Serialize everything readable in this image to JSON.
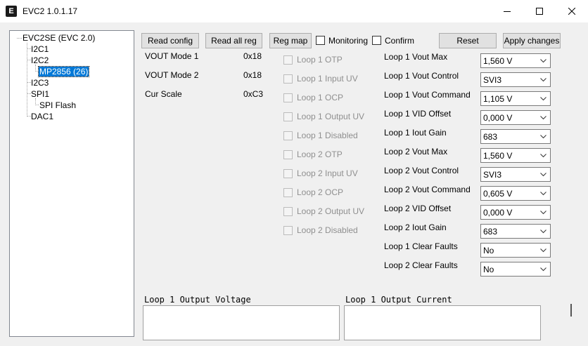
{
  "window": {
    "title": "EVC2 1.0.1.17",
    "icon_text": "E"
  },
  "tree": {
    "root": "EVC2SE (EVC 2.0)",
    "nodes": [
      "I2C1",
      "I2C2",
      "MP2856 (26)",
      "I2C3",
      "SPI1",
      "SPI Flash",
      "DAC1"
    ]
  },
  "toolbar": {
    "read_config": "Read config",
    "read_all_reg": "Read all reg",
    "reg_map": "Reg map",
    "monitoring": "Monitoring",
    "confirm": "Confirm",
    "reset": "Reset",
    "apply_changes": "Apply changes"
  },
  "info": [
    {
      "label": "VOUT Mode 1",
      "value": "0x18"
    },
    {
      "label": "VOUT Mode 2",
      "value": "0x18"
    },
    {
      "label": "Cur Scale",
      "value": "0xC3"
    }
  ],
  "status_flags": [
    "Loop 1 OTP",
    "Loop 1 Input UV",
    "Loop 1 OCP",
    "Loop 1 Output UV",
    "Loop 1 Disabled",
    "Loop 2 OTP",
    "Loop 2 Input UV",
    "Loop 2 OCP",
    "Loop 2 Output UV",
    "Loop 2 Disabled"
  ],
  "params": [
    {
      "label": "Loop 1 Vout Max",
      "value": "1,560 V"
    },
    {
      "label": "Loop 1 Vout Control",
      "value": "SVI3"
    },
    {
      "label": "Loop 1 Vout Command",
      "value": "1,105 V"
    },
    {
      "label": "Loop 1 VID Offset",
      "value": "0,000 V"
    },
    {
      "label": "Loop 1 Iout Gain",
      "value": "683"
    },
    {
      "label": "Loop 2 Vout Max",
      "value": "1,560 V"
    },
    {
      "label": "Loop 2 Vout Control",
      "value": "SVI3"
    },
    {
      "label": "Loop 2 Vout Command",
      "value": "0,605 V"
    },
    {
      "label": "Loop 2 VID Offset",
      "value": "0,000 V"
    },
    {
      "label": "Loop 2 Iout Gain",
      "value": "683"
    },
    {
      "label": "Loop 1 Clear Faults",
      "value": "No"
    },
    {
      "label": "Loop 2 Clear Faults",
      "value": "No"
    }
  ],
  "charts": {
    "voltage_title": "Loop 1 Output Voltage",
    "current_title": "Loop 1 Output Current"
  }
}
